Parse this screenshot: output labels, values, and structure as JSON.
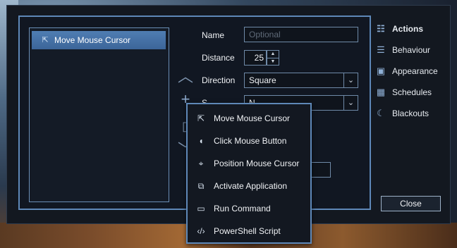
{
  "action_list": {
    "items": [
      {
        "label": "Move Mouse Cursor",
        "icon": "mouse-pointer-icon"
      }
    ]
  },
  "form": {
    "name_label": "Name",
    "name_placeholder": "Optional",
    "distance_label": "Distance",
    "distance_value": "25",
    "direction_label": "Direction",
    "direction_value": "Square",
    "speed_label": "S",
    "speed_value": "N"
  },
  "sidebar": {
    "items": [
      {
        "label": "Actions",
        "icon": "list-icon",
        "active": true
      },
      {
        "label": "Behaviour",
        "icon": "sliders-icon",
        "active": false
      },
      {
        "label": "Appearance",
        "icon": "appearance-icon",
        "active": false
      },
      {
        "label": "Schedules",
        "icon": "calendar-icon",
        "active": false
      },
      {
        "label": "Blackouts",
        "icon": "moon-icon",
        "active": false
      }
    ]
  },
  "close_label": "Close",
  "menu": {
    "items": [
      {
        "label": "Move Mouse Cursor",
        "icon": "mouse-pointer-icon"
      },
      {
        "label": "Click Mouse Button",
        "icon": "mouse-click-icon"
      },
      {
        "label": "Position Mouse Cursor",
        "icon": "crosshair-icon"
      },
      {
        "label": "Activate Application",
        "icon": "window-icon"
      },
      {
        "label": "Run Command",
        "icon": "terminal-icon"
      },
      {
        "label": "PowerShell Script",
        "icon": "code-icon"
      }
    ]
  },
  "colors": {
    "accent": "#5e88b8",
    "selection": "#4a78ad",
    "panel": "#131820"
  }
}
